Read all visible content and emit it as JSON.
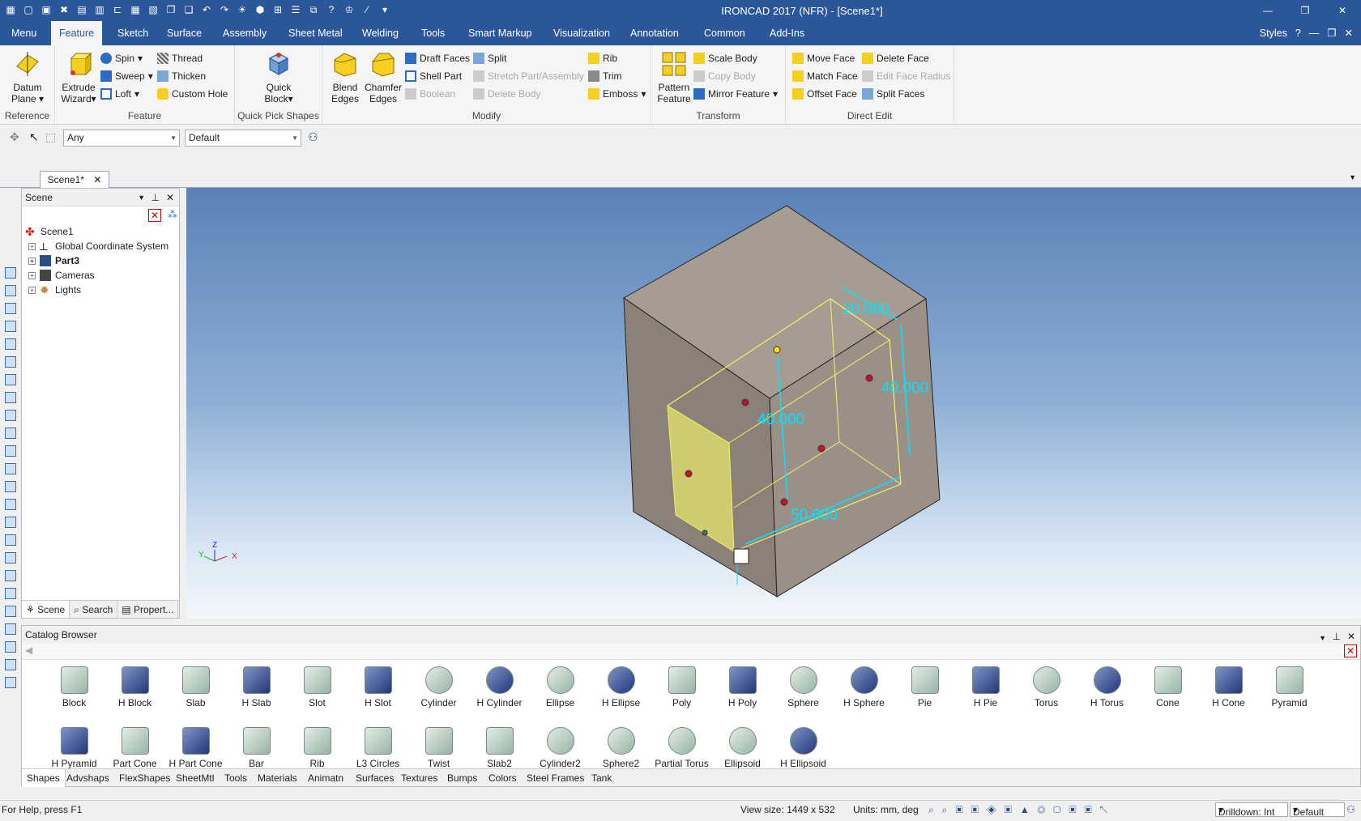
{
  "window": {
    "title": "IRONCAD 2017 (NFR) - [Scene1*]"
  },
  "menu_tabs": [
    "Menu",
    "Feature",
    "Sketch",
    "Surface",
    "Assembly",
    "Sheet Metal",
    "Welding",
    "Tools",
    "Smart Markup",
    "Visualization",
    "Annotation",
    "Common",
    "Add-Ins"
  ],
  "menu_right": {
    "styles": "Styles"
  },
  "ribbon": {
    "groups": [
      "Reference",
      "Feature",
      "Quick Pick Shapes",
      "Modify",
      "Transform",
      "Direct Edit"
    ],
    "datum": "Datum",
    "plane": "Plane",
    "extrude": "Extrude",
    "wizard": "Wizard",
    "spin": "Spin",
    "sweep": "Sweep",
    "loft": "Loft",
    "thread": "Thread",
    "thicken": "Thicken",
    "custom_hole": "Custom Hole",
    "quick": "Quick",
    "block": "Block",
    "blend": "Blend",
    "chamfer": "Chamfer",
    "edges": "Edges",
    "draft_faces": "Draft Faces",
    "shell_part": "Shell Part",
    "boolean": "Boolean",
    "split": "Split",
    "stretch": "Stretch Part/Assembly",
    "delete_body": "Delete Body",
    "rib": "Rib",
    "trim": "Trim",
    "emboss": "Emboss",
    "pattern": "Pattern",
    "feature": "Feature",
    "scale_body": "Scale Body",
    "copy_body": "Copy Body",
    "mirror_feature": "Mirror Feature",
    "move_face": "Move Face",
    "match_face": "Match Face",
    "offset_face": "Offset Face",
    "delete_face": "Delete Face",
    "edit_face_radius": "Edit Face Radius",
    "split_faces": "Split Faces"
  },
  "selection": {
    "filter": "Any",
    "style": "Default"
  },
  "document_tab": "Scene1*",
  "scene_panel": {
    "title": "Scene",
    "tree": [
      {
        "label": "Scene1",
        "bold": false
      },
      {
        "label": "Global Coordinate System",
        "bold": false
      },
      {
        "label": "Part3",
        "bold": true
      },
      {
        "label": "Cameras",
        "bold": false
      },
      {
        "label": "Lights",
        "bold": false
      }
    ],
    "tabs": [
      "Scene",
      "Search",
      "Propert..."
    ]
  },
  "viewport": {
    "dimensions": [
      "20.000",
      "40.000",
      "40.000",
      "50.000"
    ],
    "triad": {
      "x": "X",
      "y": "Y",
      "z": "Z"
    },
    "colors": {
      "dimension": "#00e5ff",
      "face": "#a89d93",
      "highlight": "#f2f26a"
    }
  },
  "catalog": {
    "title": "Catalog Browser",
    "shapes": [
      "Block",
      "H Block",
      "Slab",
      "H Slab",
      "Slot",
      "H Slot",
      "Cylinder",
      "H Cylinder",
      "Ellipse",
      "H Ellipse",
      "Poly",
      "H Poly",
      "Sphere",
      "H Sphere",
      "Pie",
      "H Pie",
      "Torus",
      "H Torus",
      "Cone",
      "H Cone",
      "Pyramid",
      "H Pyramid",
      "Part Cone",
      "H Part Cone",
      "Bar",
      "Rib",
      "L3 Circles",
      "Twist",
      "Slab2",
      "Cylinder2",
      "Sphere2",
      "Partial Torus",
      "Ellipsoid",
      "H Ellipsoid"
    ],
    "tabs": [
      "Shapes",
      "Advshaps",
      "FlexShapes",
      "SheetMtl",
      "Tools",
      "Materials",
      "Animatn",
      "Surfaces",
      "Textures",
      "Bumps",
      "Colors",
      "Steel Frames",
      "Tank"
    ]
  },
  "status": {
    "help": "For Help, press F1",
    "view_size": "View size: 1449 x  532",
    "units": "Units: mm, deg",
    "drilldown": "Drilldown: Int",
    "default": "Default"
  }
}
